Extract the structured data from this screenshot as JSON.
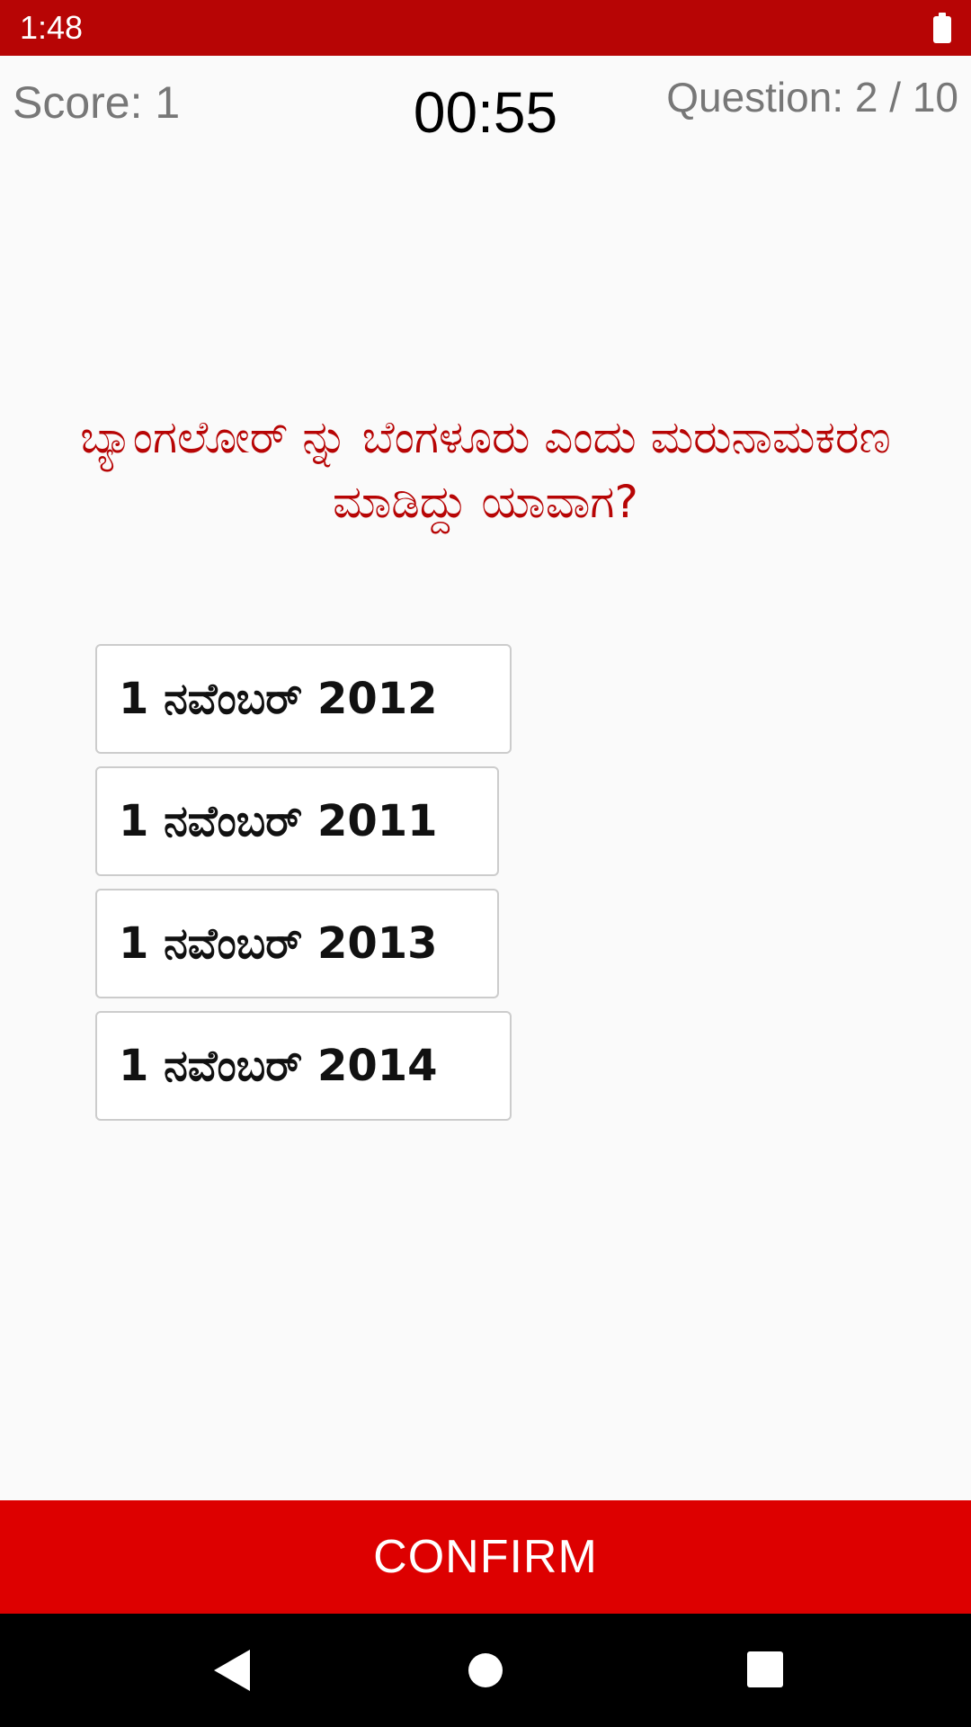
{
  "status_bar": {
    "time": "1:48",
    "battery_icon": "battery-full-icon",
    "background_color": "#b70505"
  },
  "header": {
    "score": "Score: 1",
    "timer": "00:55",
    "question_counter": "Question: 2 / 10"
  },
  "question": {
    "text": "ಬ್ಯಾಂಗಲೋರ್ ನ್ನು  ಬೆಂಗಳೂರು ಎಂದು ಮರುನಾಮಕರಣ ಮಾಡಿದ್ದು ಯಾವಾಗ?",
    "color": "#b70505"
  },
  "options": [
    {
      "label": "1 ನವೆಂಬರ್ 2012"
    },
    {
      "label": "1 ನವೆಂಬರ್ 2011"
    },
    {
      "label": "1 ನವೆಂಬರ್ 2013"
    },
    {
      "label": "1 ನವೆಂಬರ್ 2014"
    }
  ],
  "confirm": {
    "label": "CONFIRM",
    "background_color": "#dd0000"
  },
  "nav_bar": {
    "icons": [
      "back-icon",
      "home-icon",
      "recents-icon"
    ]
  }
}
